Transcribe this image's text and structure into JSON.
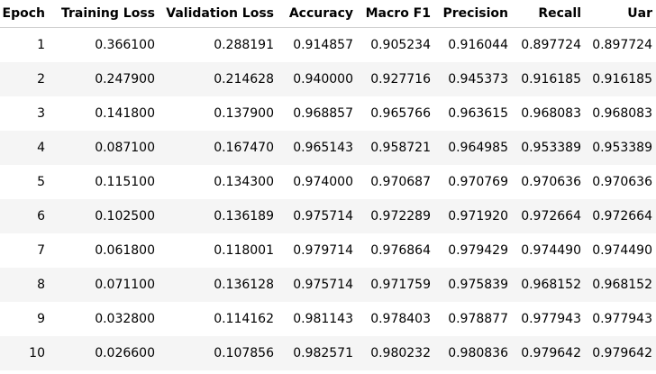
{
  "table": {
    "columns": [
      "Epoch",
      "Training Loss",
      "Validation Loss",
      "Accuracy",
      "Macro F1",
      "Precision",
      "Recall",
      "Uar"
    ],
    "rows": [
      [
        "1",
        "0.366100",
        "0.288191",
        "0.914857",
        "0.905234",
        "0.916044",
        "0.897724",
        "0.897724"
      ],
      [
        "2",
        "0.247900",
        "0.214628",
        "0.940000",
        "0.927716",
        "0.945373",
        "0.916185",
        "0.916185"
      ],
      [
        "3",
        "0.141800",
        "0.137900",
        "0.968857",
        "0.965766",
        "0.963615",
        "0.968083",
        "0.968083"
      ],
      [
        "4",
        "0.087100",
        "0.167470",
        "0.965143",
        "0.958721",
        "0.964985",
        "0.953389",
        "0.953389"
      ],
      [
        "5",
        "0.115100",
        "0.134300",
        "0.974000",
        "0.970687",
        "0.970769",
        "0.970636",
        "0.970636"
      ],
      [
        "6",
        "0.102500",
        "0.136189",
        "0.975714",
        "0.972289",
        "0.971920",
        "0.972664",
        "0.972664"
      ],
      [
        "7",
        "0.061800",
        "0.118001",
        "0.979714",
        "0.976864",
        "0.979429",
        "0.974490",
        "0.974490"
      ],
      [
        "8",
        "0.071100",
        "0.136128",
        "0.975714",
        "0.971759",
        "0.975839",
        "0.968152",
        "0.968152"
      ],
      [
        "9",
        "0.032800",
        "0.114162",
        "0.981143",
        "0.978403",
        "0.978877",
        "0.977943",
        "0.977943"
      ],
      [
        "10",
        "0.026600",
        "0.107856",
        "0.982571",
        "0.980232",
        "0.980836",
        "0.979642",
        "0.979642"
      ]
    ]
  },
  "colors": {
    "striped_row": "#f5f5f5",
    "header_border": "#d0d0d0",
    "text": "#000000"
  }
}
